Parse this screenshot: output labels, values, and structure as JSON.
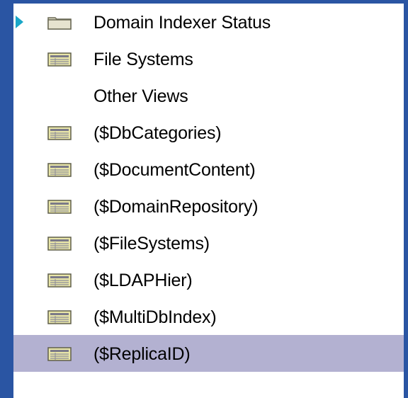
{
  "tree": {
    "items": [
      {
        "label": "Domain Indexer Status",
        "icon": "folder-icon",
        "expandable": true,
        "selected": false
      },
      {
        "label": "File Systems",
        "icon": "view-icon",
        "expandable": false,
        "selected": false
      },
      {
        "label": "Other Views",
        "icon": "",
        "expandable": false,
        "selected": false
      },
      {
        "label": "($DbCategories)",
        "icon": "view-icon",
        "expandable": false,
        "selected": false
      },
      {
        "label": "($DocumentContent)",
        "icon": "view-icon",
        "expandable": false,
        "selected": false
      },
      {
        "label": "($DomainRepository)",
        "icon": "view-icon",
        "expandable": false,
        "selected": false
      },
      {
        "label": "($FileSystems)",
        "icon": "view-icon",
        "expandable": false,
        "selected": false
      },
      {
        "label": "($LDAPHier)",
        "icon": "view-icon",
        "expandable": false,
        "selected": false
      },
      {
        "label": "($MultiDbIndex)",
        "icon": "view-icon",
        "expandable": false,
        "selected": false
      },
      {
        "label": "($ReplicaID)",
        "icon": "view-icon",
        "expandable": false,
        "selected": true
      }
    ]
  },
  "colors": {
    "frame_border": "#2a55a3",
    "selection_background": "#b3b1d1",
    "expand_arrow": "#19a7c8",
    "folder_fill": "#d9d6c0",
    "view_icon_fill": "#e9e6a8"
  }
}
